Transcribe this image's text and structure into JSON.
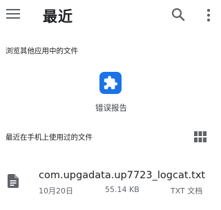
{
  "appbar": {
    "title": "最近",
    "icons": {
      "menu": "menu-icon",
      "search": "search-icon",
      "more": "more-vert-icon"
    }
  },
  "browse_section": {
    "title": "浏览其他应用中的文件",
    "apps": [
      {
        "label": "错误报告",
        "icon": "puzzle-icon",
        "color": "#1a73e8"
      }
    ]
  },
  "recent_section": {
    "title": "最近在手机上使用过的文件",
    "view_toggle_icon": "grid-view-icon",
    "files": [
      {
        "name": "com.upgadata.up7723_logcat.txt",
        "date": "10月20日",
        "size": "55.14 KB",
        "type": "TXT 文档",
        "icon": "document-icon"
      }
    ]
  }
}
